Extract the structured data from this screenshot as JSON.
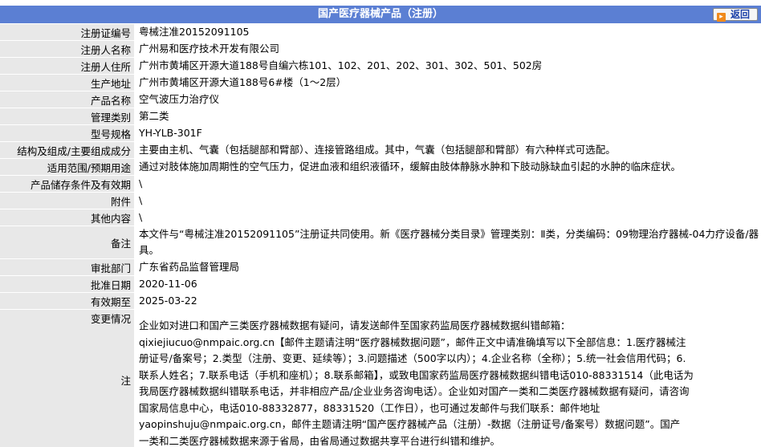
{
  "header": {
    "title": "国产医疗器械产品（注册）",
    "back_label": "返回",
    "back_arrow": "▸"
  },
  "rows": [
    {
      "label": "注册证编号",
      "value": "粤械注准20152091105"
    },
    {
      "label": "注册人名称",
      "value": "广州易和医疗技术开发有限公司"
    },
    {
      "label": "注册人住所",
      "value": "广州市黄埔区开源大道188号自编六栋101、102、201、202、301、302、501、502房"
    },
    {
      "label": "生产地址",
      "value": "广州市黄埔区开源大道188号6#楼（1～2层）"
    },
    {
      "label": "产品名称",
      "value": "空气波压力治疗仪"
    },
    {
      "label": "管理类别",
      "value": "第二类"
    },
    {
      "label": "型号规格",
      "value": "YH-YLB-301F"
    },
    {
      "label": "结构及组成/主要组成成分",
      "value": "主要由主机、气囊（包括腿部和臂部）、连接管路组成。其中，气囊（包括腿部和臂部）有六种样式可选配。"
    },
    {
      "label": "适用范围/预期用途",
      "value": "通过对肢体施加周期性的空气压力，促进血液和组织液循环，缓解由肢体静脉水肿和下肢动脉缺血引起的水肿的临床症状。"
    },
    {
      "label": "产品储存条件及有效期",
      "value": "\\"
    },
    {
      "label": "附件",
      "value": "\\"
    },
    {
      "label": "其他内容",
      "value": "\\"
    }
  ],
  "remark": {
    "label": "备注",
    "value": "本文件与“粤械注准20152091105”注册证共同使用。新《医疗器械分类目录》管理类别：Ⅱ类，分类编码：09物理治疗器械-04力疗设备/器具。"
  },
  "rows2": [
    {
      "label": "审批部门",
      "value": "广东省药品监督管理局"
    },
    {
      "label": "批准日期",
      "value": "2020-11-06"
    },
    {
      "label": "有效期至",
      "value": "2025-03-22"
    }
  ],
  "change": {
    "label": "变更情况",
    "value": ""
  },
  "note": {
    "label": "注",
    "lines": [
      "企业如对进口和国产三类医疗器械数据有疑问，请发送邮件至国家药监局医疗器械数据纠错邮箱：",
      "qixiejiucuo@nmpaic.org.cn【邮件主题请注明“医疗器械数据问题”，邮件正文中请准确填写以下全部信息：1.医疗器械注",
      "册证号/备案号；2.类型（注册、变更、延续等）；3.问题描述（500字以内）；4.企业名称（全称）；5.统一社会信用代码；6.",
      "联系人姓名；7.联系电话（手机和座机）；8.联系邮箱】，或致电国家药监局医疗器械数据纠错电话010-88331514（此电话为",
      "我局医疗器械数据纠错联系电话，并非相应产品/企业业务咨询电话）。企业如对国产一类和二类医疗器械数据有疑问，请咨询",
      "国家局信息中心，电话010-88332877，88331520（工作日），也可通过发邮件与我们联系：邮件地址",
      "yaopinshuju@nmpaic.org.cn，邮件主题请注明“国产医疗器械产品（注册）-数据（注册证号/备案号）数据问题”。国产",
      "一类和二类医疗器械数据来源于省局，由省局通过数据共享平台进行纠错和维护。"
    ]
  }
}
